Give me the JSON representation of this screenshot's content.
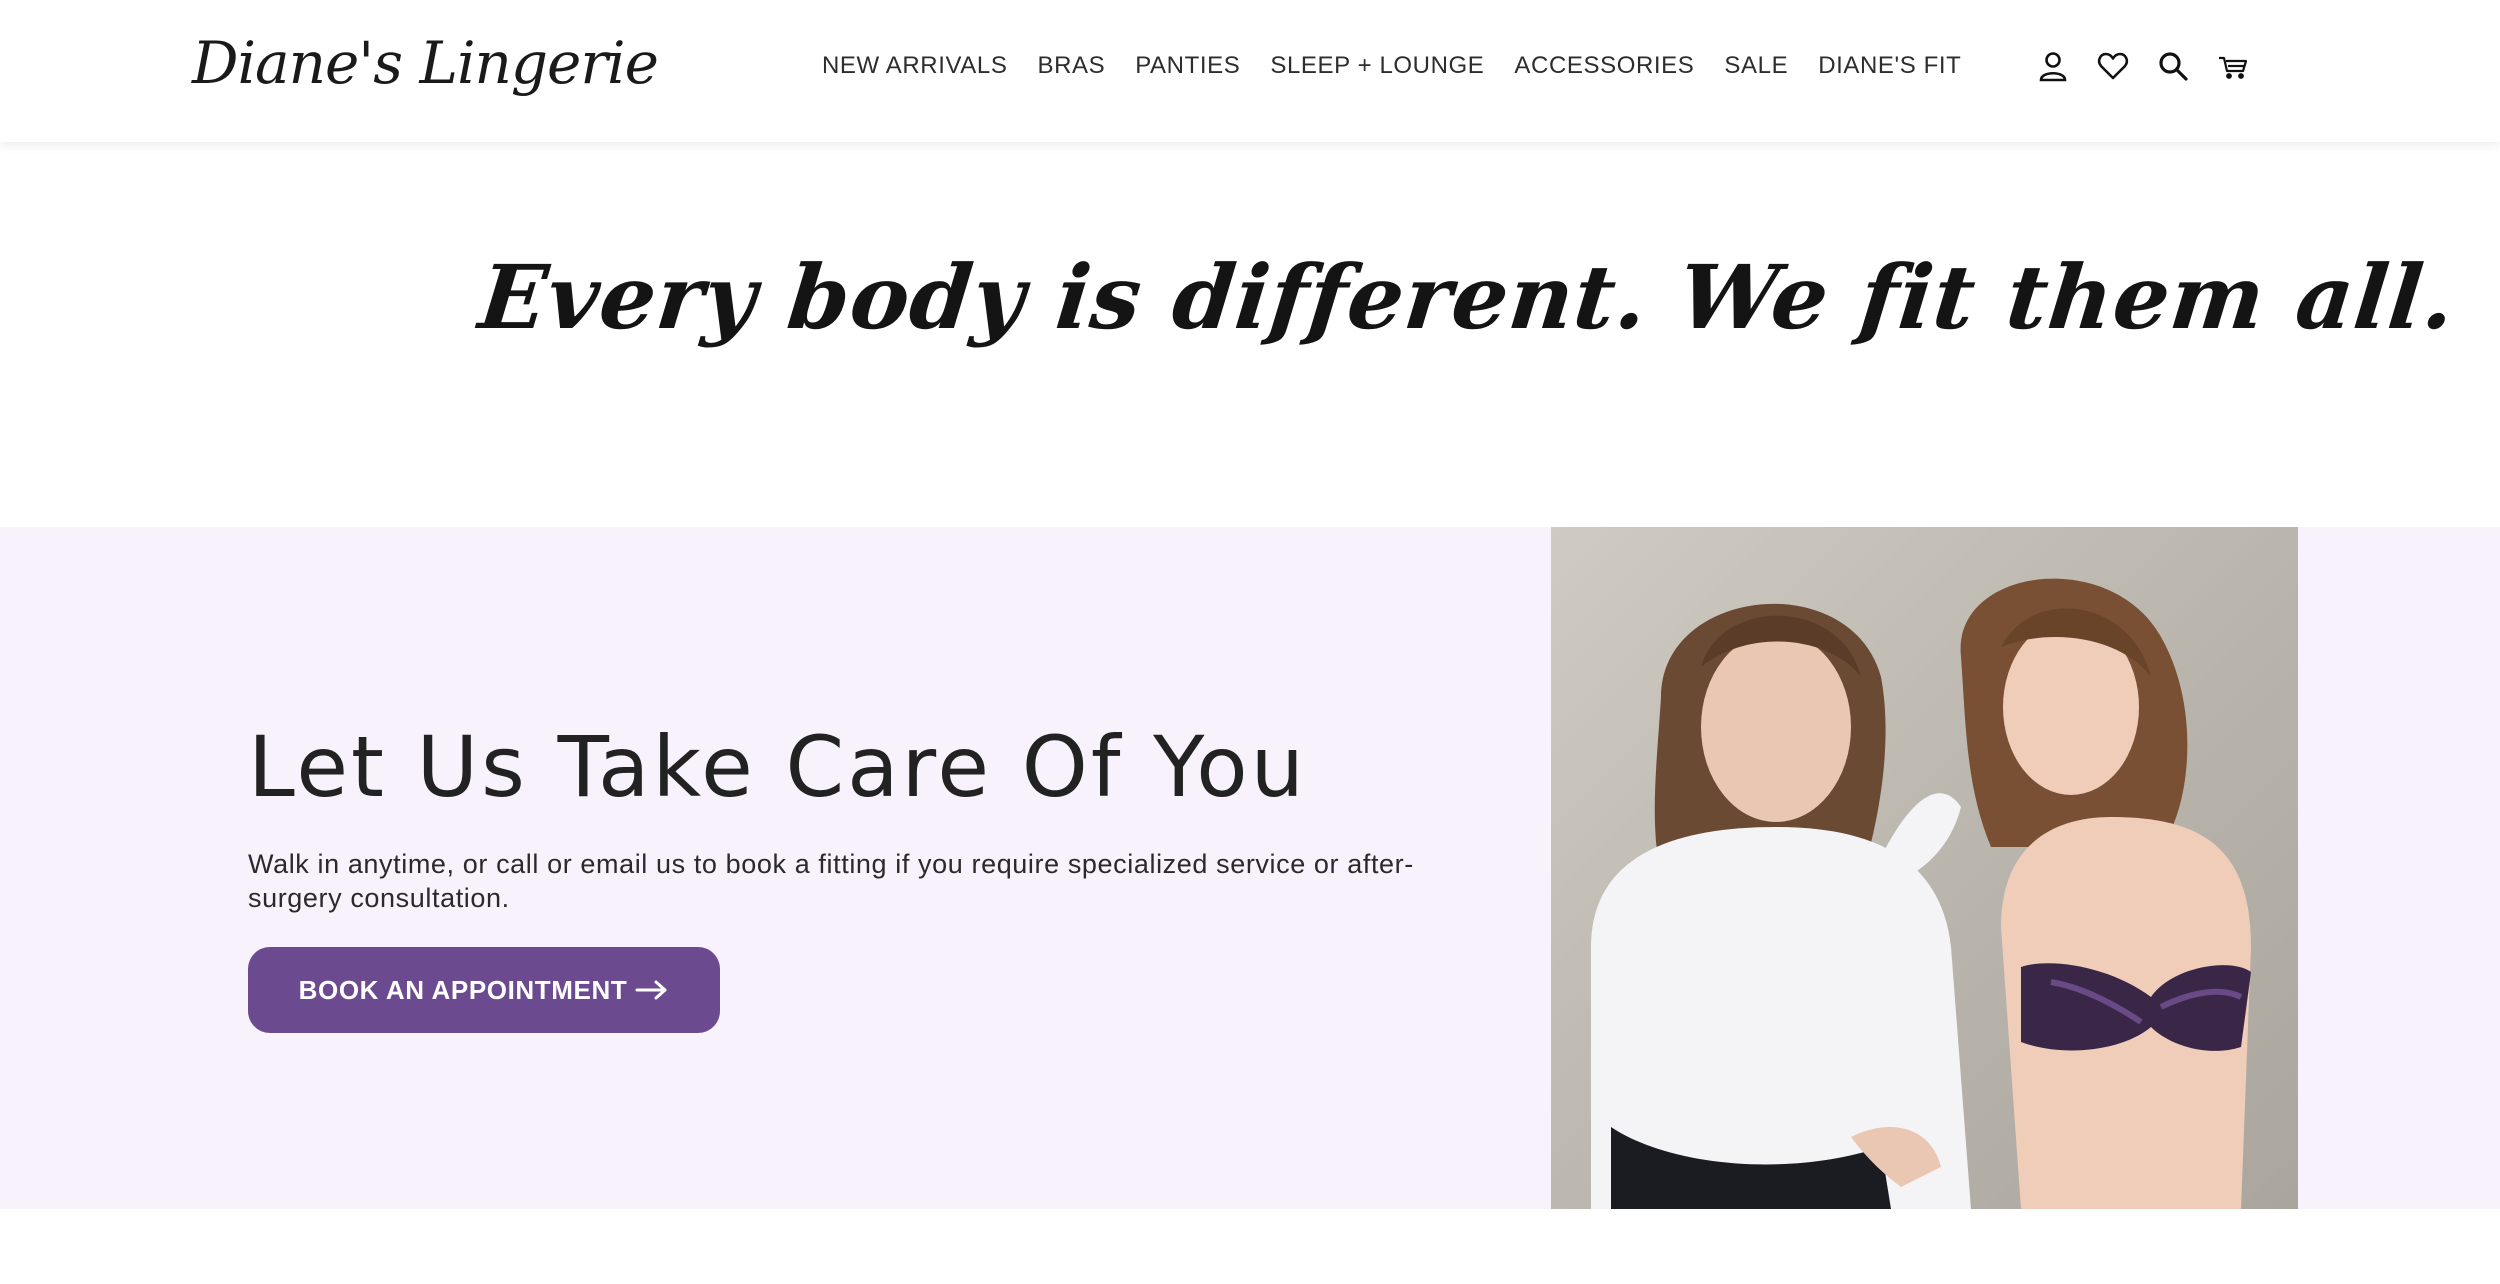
{
  "brand": {
    "logo_text": "Diane's Lingerie"
  },
  "nav": {
    "items": [
      {
        "label": "NEW ARRIVALS"
      },
      {
        "label": "BRAS"
      },
      {
        "label": "PANTIES"
      },
      {
        "label": "SLEEP + LOUNGE"
      },
      {
        "label": "ACCESSORIES"
      },
      {
        "label": "SALE"
      },
      {
        "label": "DIANE'S FIT"
      }
    ]
  },
  "header_icons": [
    "account-icon",
    "wishlist-heart-icon",
    "search-icon",
    "cart-icon"
  ],
  "tagline": {
    "text": "Every body is different. We fit them all."
  },
  "care": {
    "heading": "Let Us Take Care Of You",
    "body": "Walk in anytime, or call or email us to book a fitting if you require specialized service or after-surgery consultation.",
    "button_label": "BOOK AN APPOINTMENT",
    "button_icon": "arrow-right-icon"
  },
  "colors": {
    "accent_purple": "#6b4a90",
    "section_bg": "#f7f2fb",
    "text_dark": "#222222"
  }
}
